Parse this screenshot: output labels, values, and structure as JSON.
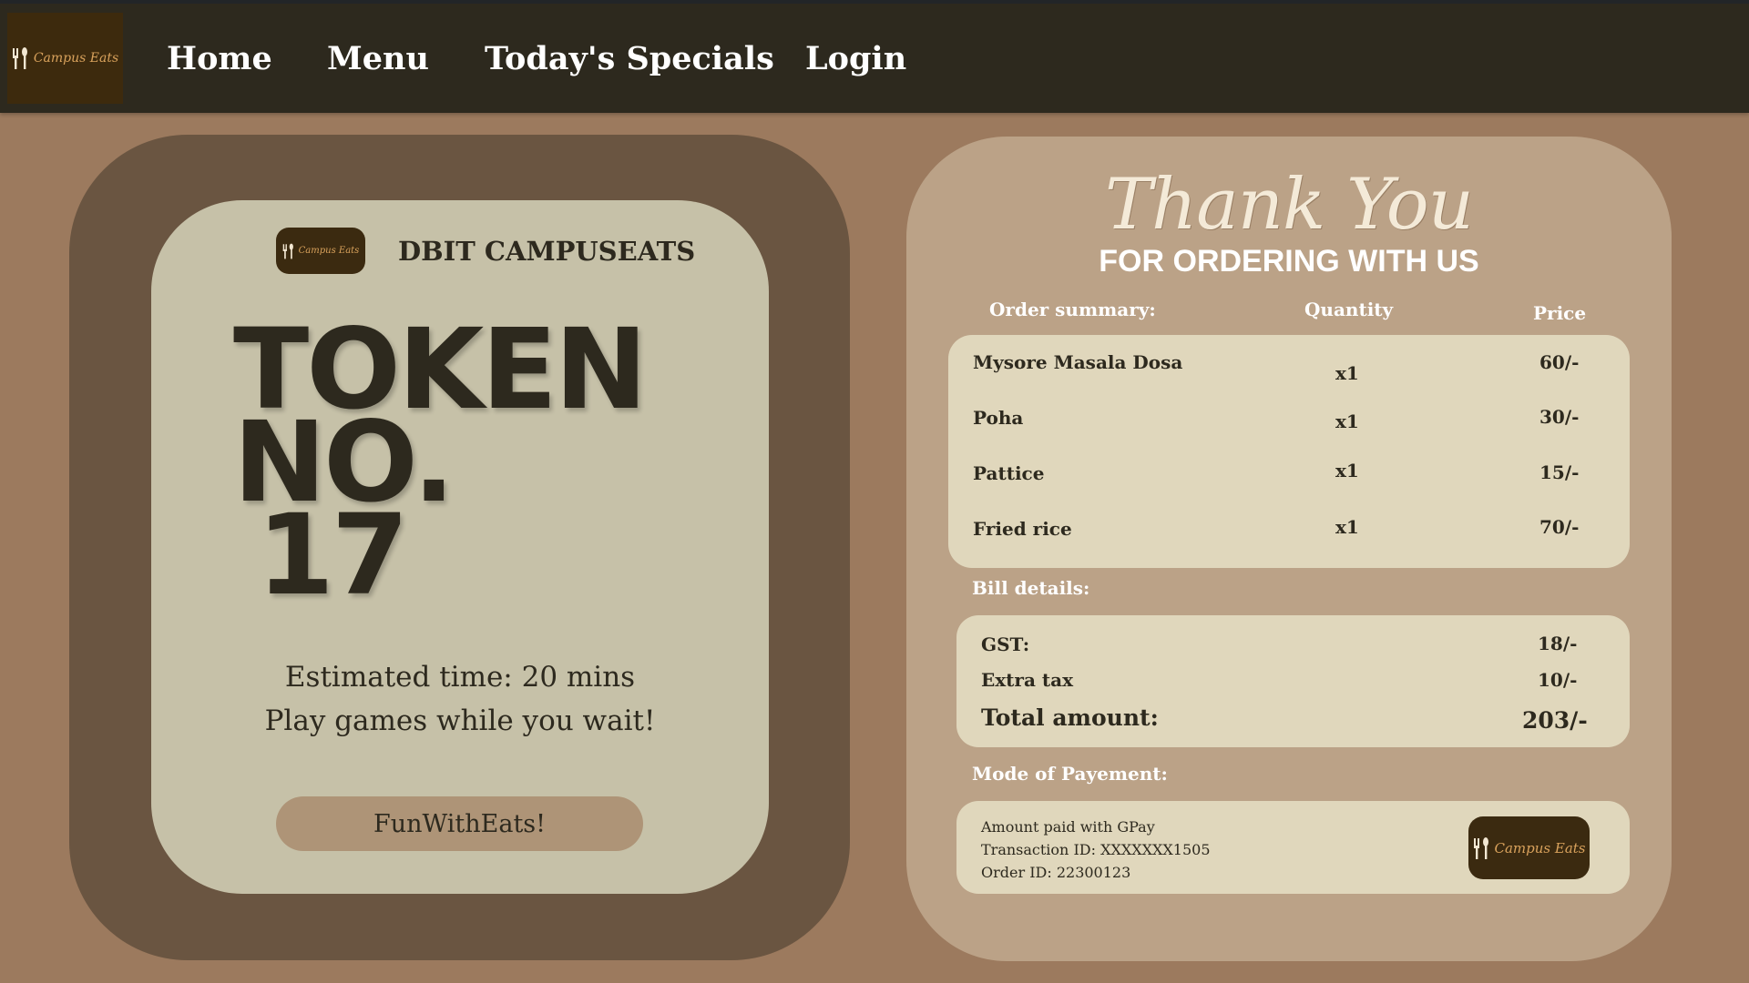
{
  "brand": {
    "logo_text": "Campus Eats",
    "name": "DBIT CAMPUSEATS"
  },
  "nav": {
    "items": [
      "Home",
      "Menu",
      "Today's Specials",
      "Login"
    ]
  },
  "token": {
    "line1": "TOKEN",
    "line2": "NO.",
    "number": "17",
    "estimated": "Estimated time: 20 mins",
    "play": "Play games while you wait!",
    "button": "FunWithEats!"
  },
  "thanks": {
    "title": "Thank You",
    "subtitle": "FOR ORDERING WITH US"
  },
  "order": {
    "headers": {
      "summary": "Order summary:",
      "quantity": "Quantity",
      "price": "Price"
    },
    "items": [
      {
        "name": "Mysore Masala Dosa",
        "qty": "x1",
        "price": "60/-"
      },
      {
        "name": "Poha",
        "qty": "x1",
        "price": "30/-"
      },
      {
        "name": "Pattice",
        "qty": "x1",
        "price": "15/-"
      },
      {
        "name": "Fried rice",
        "qty": "x1",
        "price": "70/-"
      }
    ]
  },
  "bill": {
    "label": "Bill details:",
    "gst_label": "GST:",
    "gst_value": "18/-",
    "extra_label": "Extra tax",
    "extra_value": "10/-",
    "total_label": "Total amount:",
    "total_value": "203/-"
  },
  "payment": {
    "label": "Mode of Payement:",
    "line1": "Amount paid with GPay",
    "line2": "Transaction ID: XXXXXXX1505",
    "line3": "Order ID: 22300123"
  },
  "colors": {
    "background": "#9c7a5e",
    "topbar": "#2d291e",
    "left_outer": "#6a5541",
    "token_card": "#c6c1a8",
    "right_outer": "#bba287",
    "card": "#e0d7bc",
    "accent": "#d9a25c"
  }
}
